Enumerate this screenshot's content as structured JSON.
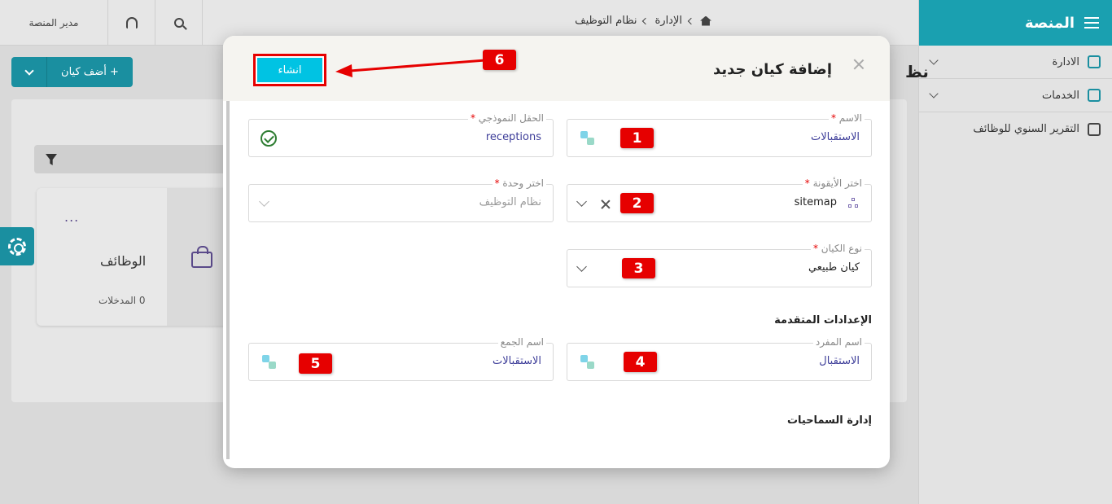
{
  "sidebar": {
    "title": "المنصة",
    "items": [
      {
        "label": "الادارة"
      },
      {
        "label": "الخدمات"
      },
      {
        "label": "التقرير السنوي للوظائف"
      }
    ]
  },
  "topbar": {
    "breadcrumb": [
      "الإدارة",
      "نظام التوظيف"
    ],
    "user_label": "مدير المنصة"
  },
  "background": {
    "add_entity_label": "أضف كيان",
    "page_title_fragment": "نظ",
    "card": {
      "title": "الوظائف",
      "entries": "0 المدخلات",
      "menu": "..."
    }
  },
  "modal": {
    "title": "إضافة كيان جديد",
    "create_label": "انشاء",
    "fields": {
      "name": {
        "label": "الاسم",
        "value": "الاستقبالات"
      },
      "model_field": {
        "label": "الحقل النموذجي",
        "value": "receptions"
      },
      "icon": {
        "label": "اختر الأيقونة",
        "value": "sitemap"
      },
      "unit": {
        "label": "اختر وحدة",
        "value": "نظام التوظيف"
      },
      "entity_type": {
        "label": "نوع الكيان",
        "value": "كيان طبيعي"
      },
      "singular": {
        "label": "اسم المفرد",
        "value": "الاستقبال"
      },
      "plural": {
        "label": "اسم الجمع",
        "value": "الاستقبالات"
      }
    },
    "advanced_title": "الإعدادات المتقدمة",
    "permissions_title": "إدارة السماحيات",
    "required_mark": "*"
  },
  "annotations": [
    "1",
    "2",
    "3",
    "4",
    "5",
    "6"
  ],
  "colors": {
    "accent": "#1aa0b0",
    "create_button": "#00c3e3",
    "annotation_red": "#e60000"
  }
}
